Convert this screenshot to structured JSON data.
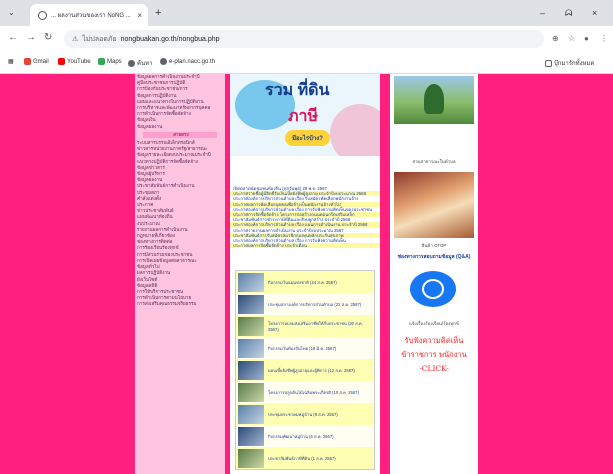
{
  "browser": {
    "tab_title": "... ผลงานส่วนของเรา NoNG ...",
    "new_tab": "+",
    "url_warning": "⚠",
    "url_insecure_label": "ไม่ปลอดภัย",
    "url": "nongbuakan.go.th/nongbua.php",
    "window_minimize": "–",
    "window_restore": "ᗣ",
    "window_close": "×",
    "bookmarks": [
      {
        "label": "Gmail",
        "color": "#ea4335"
      },
      {
        "label": "YouTube",
        "color": "#ff0000"
      },
      {
        "label": "Maps",
        "color": "#34a853"
      },
      {
        "label": "ค้นหา",
        "color": "#5f6368"
      },
      {
        "label": "e-plan.nacc.go.th",
        "color": "#5f6368"
      }
    ],
    "bookmarks_right": "บุ๊กมาร์กทั้งหมด"
  },
  "left_menu": [
    "ข้อมูลผลการดำเนินงานประจำปี",
    "คู่มือประชาชนการปฏิบัติ",
    "การป้องกันประชาชน/การ",
    "ข้อมูลการปฏิบัติงาน",
    "แผนและแนวทางในการปฏิบัติงาน",
    "การบริหารและพัฒนาทรัพยากรบุคคล",
    "การดำเนินการจัดซื้อจัดจ้าง",
    "ข้อมูลเงิน",
    "ข้อมูลผลงาน",
    "สายตรง",
    "ระบบสารบรรณอิเล็กทรอนิกส์",
    "ข่าวสารหน่วยงานภาครัฐ/สาธารณะ",
    "ข้อมูลรายละเอียดงบประมาณประจำปี",
    "แนวทางปฏิบัติการจัดซื้อจัดจ้าง",
    "ข้อมูลข่าวสาร",
    "ข้อมูลผู้บริหาร",
    "ข้อมูลผลงาน",
    "ประชาสัมพันธ์การดำเนินงาน",
    "ประชุมสภา",
    "คำสั่งแต่งตั้ง",
    "ประกาศ",
    "ข่าวประชาสัมพันธ์",
    "แผนพัฒนาท้องถิ่น",
    "งบประมาณ",
    "รายงานผลการดำเนินงาน",
    "กฎหมายที่เกี่ยวข้อง",
    "ช่องทางการติดต่อ",
    "การร้องเรียนร้องทุกข์",
    "การมีส่วนร่วมของประชาชน",
    "การเปิดเผยข้อมูลต่อสาธารณะ",
    "ข้อมูลทั่วไป",
    "ผลการปฏิบัติงาน",
    "ผังเว็บไซต์",
    "ข้อมูลสถิติ",
    "การให้บริการประชาชน",
    "การดำเนินการตามนโยบาย",
    "การส่งเสริมคุณธรรมจริยธรรม"
  ],
  "left_menu_highlight_index": 9,
  "banner": {
    "line1": "รวม ที่ดิน",
    "line2": "ภาษี",
    "button": "มีอะไรบ้าง?"
  },
  "news_items": [
    "เปิดตลาดนัดชุมชนท้องถิ่น (ทุกวันพุธ) 28 พ.ย. 2567",
    "ประกาศรายชื่อผู้มีสิทธิ์รับเงินเบี้ยยังชีพผู้สูงอายุ ประจำปีงบประมาณ 2568",
    "ประกาศองค์การบริหารส่วนตำบล เรื่อง รับสมัครคัดเลือกพนักงานจ้าง",
    "ประกาศผลการคัดเลือกบุคคลเพื่อจ้างเป็นพนักงานจ้างทั่วไป",
    "ประกาศองค์การบริหารส่วนตำบล เรื่อง การรับฟังความคิดเห็นของประชาชน",
    "ประกาศการจัดซื้อจัดจ้าง โครงการก่อสร้างถนนคอนกรีตเสริมเหล็ก",
    "ประชาสัมพันธ์การชำระภาษีที่ดินและสิ่งปลูกสร้าง ประจำปี 2568",
    "ประกาศองค์การบริหารส่วนตำบล เรื่อง แผนการดำเนินงาน ประจำปี 2568",
    "ประกาศรายงานผลการดำเนินงาน ประจำปีงบประมาณ 2567",
    "ประชาสัมพันธ์การรับสมัครสมาชิกกองทุนหลักประกันสุขภาพ",
    "ประกาศองค์การบริหารส่วนตำบล เรื่อง การรับฟังความคิดเห็น",
    "ประกาศผลการจัดซื้อจัดจ้าง ประจำเดือน"
  ],
  "videos": [
    "กิจกรรมวันแม่แห่งชาติ (24 ส.ค. 2567)",
    "ประชุมสภาองค์การบริหารส่วนตำบล (22 ส.ค. 2567)",
    "โครงการอบรมส่งเสริมอาชีพให้กับประชาชน (20 ส.ค. 2567)",
    "กิจกรรมวันท้องถิ่นไทย (18 มี.ค. 2567)",
    "มอบเบี้ยยังชีพผู้สูงอายุและผู้พิการ (12 ส.ค. 2567)",
    "โครงการปลูกต้นไม้เฉลิมพระเกียรติ (10 ส.ค. 2567)",
    "ประชุมประชาคมหมู่บ้าน (8 ส.ค. 2567)",
    "กิจกรรมพัฒนาหมู่บ้าน (5 ส.ค. 2567)",
    "ประชาสัมพันธ์ภาษีที่ดิน (1 ส.ค. 2567)"
  ],
  "right": {
    "park_caption": "สวนสาธารณะในตำบล",
    "otop_caption": "สินค้า OTOP",
    "qa_title": "ช่องทางการสอบถามข้อมูล (Q&A)",
    "qa_caption": "แจ้งเรื่องร้องเรียน/ร้องทุกข์",
    "complaint_line1": "รับฟังความคิดเห็น",
    "complaint_line2": "ข้าราชการ พนักงาน",
    "complaint_line3": "-CLICK-"
  },
  "colors": {
    "page_background": "#ff1f7f",
    "menu_background": "#ffc5e0",
    "link_blue": "#1a3d9a",
    "complaint_red": "#ff1f1f"
  }
}
